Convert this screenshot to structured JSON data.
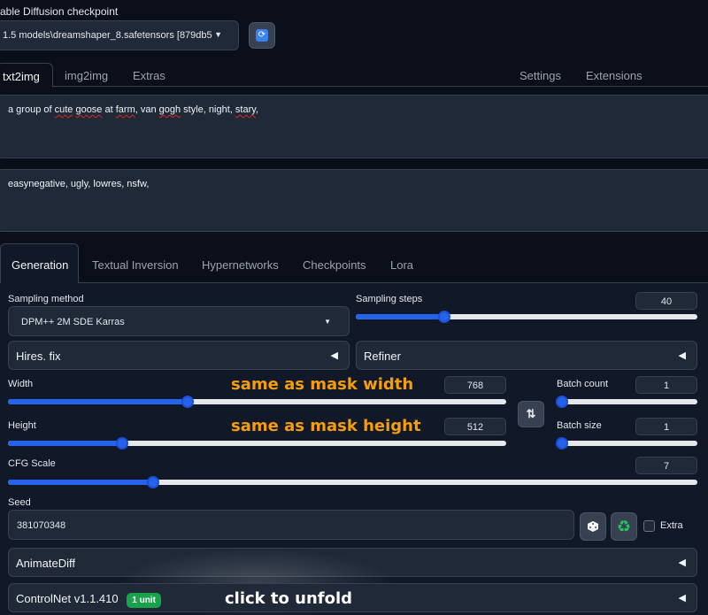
{
  "checkpoint": {
    "label": "able Diffusion checkpoint",
    "value": "1.5 models\\dreamshaper_8.safetensors [879db5",
    "refresh_icon": "refresh-icon"
  },
  "main_tabs": {
    "txt2img": "txt2img",
    "img2img": "img2img",
    "extras": "Extras",
    "settings": "Settings",
    "extensions": "Extensions"
  },
  "prompts": {
    "positive_parts": [
      "a group of ",
      "cute",
      " ",
      "goose",
      " at ",
      "farm",
      ", van ",
      "gogh",
      " style, night, ",
      "stary",
      ","
    ],
    "negative": "easynegative, ugly, lowres, nsfw,"
  },
  "gen_tabs": {
    "generation": "Generation",
    "textual_inversion": "Textual Inversion",
    "hypernetworks": "Hypernetworks",
    "checkpoints": "Checkpoints",
    "lora": "Lora"
  },
  "sampling": {
    "method_label": "Sampling method",
    "method_value": "DPM++ 2M SDE Karras",
    "steps_label": "Sampling steps",
    "steps_value": "40",
    "steps_fraction": 0.26
  },
  "accordions": {
    "hires": "Hires. fix",
    "refiner": "Refiner",
    "animatediff": "AnimateDiff",
    "controlnet": "ControlNet v1.1.410",
    "controlnet_badge": "1 unit"
  },
  "size": {
    "width_label": "Width",
    "width_value": "768",
    "width_fraction": 0.36,
    "height_label": "Height",
    "height_value": "512",
    "height_fraction": 0.23,
    "swap_icon": "swap-arrows-icon"
  },
  "batch": {
    "count_label": "Batch count",
    "count_value": "1",
    "count_fraction": 0.0,
    "size_label": "Batch size",
    "size_value": "1",
    "size_fraction": 0.0
  },
  "cfg": {
    "label": "CFG Scale",
    "value": "7",
    "fraction": 0.21
  },
  "seed": {
    "label": "Seed",
    "value": "381070348",
    "dice_icon": "dice-icon",
    "recycle_icon": "recycle-icon",
    "extra_label": "Extra"
  },
  "annotations": {
    "width_note": "same as mask width",
    "height_note": "same as mask height",
    "unfold_note": "click to unfold"
  }
}
